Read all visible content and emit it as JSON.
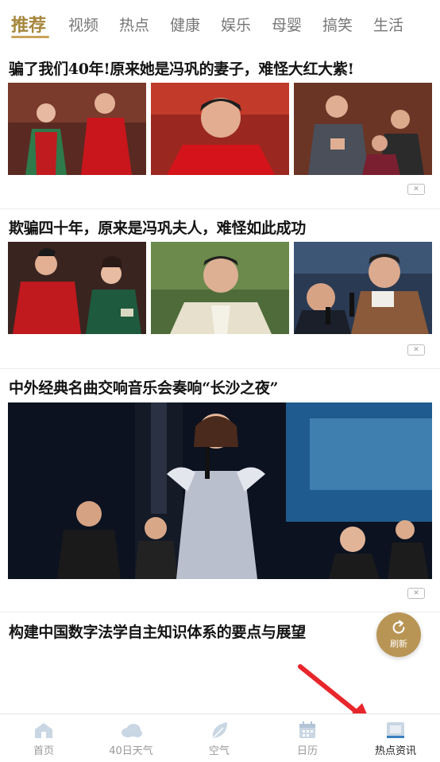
{
  "tabs": [
    "推荐",
    "视频",
    "热点",
    "健康",
    "娱乐",
    "母婴",
    "搞笑",
    "生活"
  ],
  "articles": [
    {
      "title": "骗了我们40年!原来她是冯巩的妻子，难怪大红大紫!"
    },
    {
      "title": "欺骗四十年，原来是冯巩夫人，难怪如此成功"
    },
    {
      "title": "中外经典名曲交响音乐会奏响“长沙之夜”"
    },
    {
      "title": "构建中国数字法学自主知识体系的要点与展望"
    }
  ],
  "close_glyph": "✕",
  "refresh": {
    "label": "刷新",
    "icon": "refresh-icon"
  },
  "bottom_nav": [
    {
      "label": "首页",
      "icon": "home-icon"
    },
    {
      "label": "40日天气",
      "icon": "cloud-icon"
    },
    {
      "label": "空气",
      "icon": "leaf-icon"
    },
    {
      "label": "日历",
      "icon": "calendar-icon"
    },
    {
      "label": "热点资讯",
      "icon": "news-icon",
      "active": true
    }
  ],
  "colors": {
    "accent": "#c8a45a",
    "arrow": "#e8262b",
    "nav_icon": "#c9d6e3"
  }
}
